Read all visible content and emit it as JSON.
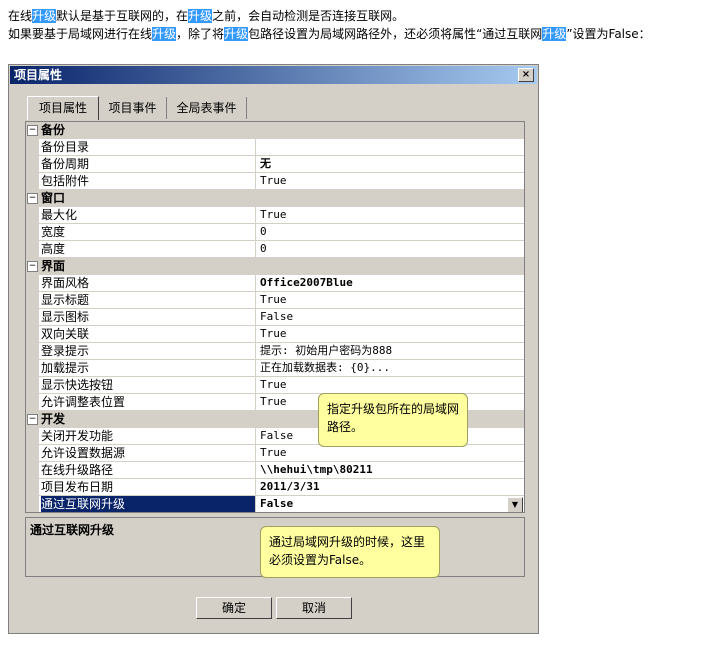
{
  "intro": {
    "line1": {
      "a": "在线",
      "b": "升级",
      "c": "默认是基于互联网的，在",
      "d": "升级",
      "e": "之前，会自动检测是否连接互联网。"
    },
    "line2": {
      "a": "如果要基于局域网进行在线",
      "b": "升级",
      "c": "，除了将",
      "d": "升级",
      "e": "包路径设置为局域网路径外，还必须将属性“通过互联网",
      "f": "升级",
      "g": "”设置为False："
    }
  },
  "dialog": {
    "title": "项目属性",
    "close": "×",
    "tabs": [
      "项目属性",
      "项目事件",
      "全局表事件"
    ],
    "categories": [
      {
        "name": "备份",
        "props": [
          {
            "name": "备份目录",
            "value": ""
          },
          {
            "name": "备份周期",
            "value": "无"
          },
          {
            "name": "包括附件",
            "value": "True"
          }
        ]
      },
      {
        "name": "窗口",
        "props": [
          {
            "name": "最大化",
            "value": "True"
          },
          {
            "name": "宽度",
            "value": "0"
          },
          {
            "name": "高度",
            "value": "0"
          }
        ]
      },
      {
        "name": "界面",
        "props": [
          {
            "name": "界面风格",
            "value": "Office2007Blue"
          },
          {
            "name": "显示标题",
            "value": "True"
          },
          {
            "name": "显示图标",
            "value": "False"
          },
          {
            "name": "双向关联",
            "value": "True"
          },
          {
            "name": "登录提示",
            "value": "提示: 初始用户密码为888"
          },
          {
            "name": "加载提示",
            "value": "正在加载数据表: {0}..."
          },
          {
            "name": "显示快选按钮",
            "value": "True"
          },
          {
            "name": "允许调整表位置",
            "value": "True"
          }
        ]
      },
      {
        "name": "开发",
        "props": [
          {
            "name": "关闭开发功能",
            "value": "False"
          },
          {
            "name": "允许设置数据源",
            "value": "True"
          },
          {
            "name": "在线升级路径",
            "value": "\\\\hehui\\tmp\\80211"
          },
          {
            "name": "项目发布日期",
            "value": "2011/3/31"
          },
          {
            "name": "通过互联网升级",
            "value": "False"
          }
        ]
      }
    ],
    "description_title": "通过互联网升级",
    "ok": "确定",
    "cancel": "取消"
  },
  "callouts": {
    "c1": "指定升级包所在的局域网路径。",
    "c2": "通过局域网升级的时候，这里必须设置为False。"
  }
}
